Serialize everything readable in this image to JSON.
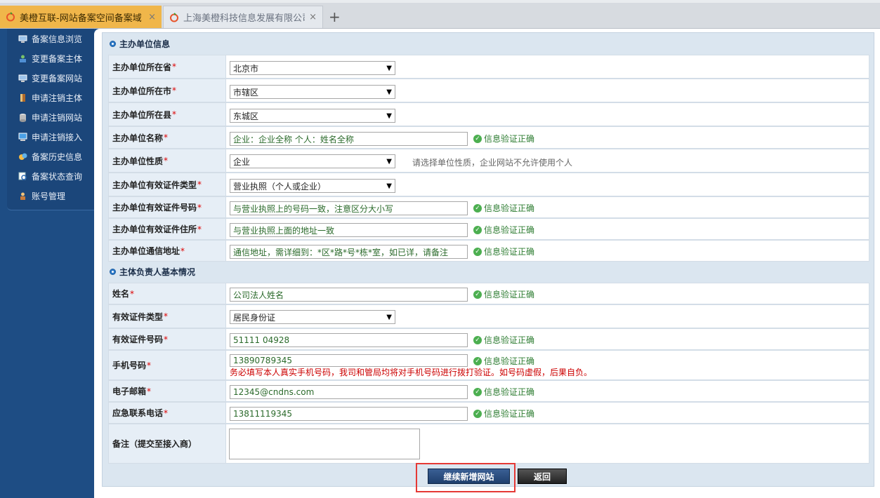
{
  "browser": {
    "tabs": [
      {
        "label": "美橙互联-网站备案空间备案域",
        "close": "×"
      },
      {
        "label": "上海美橙科技信息发展有限公司",
        "close": "×"
      }
    ],
    "new_tab": "+"
  },
  "sidebar": {
    "items": [
      {
        "label": "备案信息浏览",
        "icon": "monitor-icon"
      },
      {
        "label": "变更备案主体",
        "icon": "users-icon"
      },
      {
        "label": "变更备案网站",
        "icon": "monitor-icon"
      },
      {
        "label": "申请注销主体",
        "icon": "door-icon"
      },
      {
        "label": "申请注销网站",
        "icon": "database-icon"
      },
      {
        "label": "申请注销接入",
        "icon": "computer-icon"
      },
      {
        "label": "备案历史信息",
        "icon": "history-icon"
      },
      {
        "label": "备案状态查询",
        "icon": "search-doc-icon"
      },
      {
        "label": "账号管理",
        "icon": "user-icon"
      }
    ]
  },
  "sections": {
    "org": "主办单位信息",
    "person": "主体负责人基本情况"
  },
  "org_rows": {
    "province": {
      "label": "主办单位所在省",
      "value": "北京市"
    },
    "city": {
      "label": "主办单位所在市",
      "value": "市辖区"
    },
    "county": {
      "label": "主办单位所在县",
      "value": "东城区"
    },
    "name": {
      "label": "主办单位名称",
      "value": "企业：企业全称 个人：姓名全称",
      "ok": "信息验证正确"
    },
    "nature": {
      "label": "主办单位性质",
      "value": "企业",
      "hint": "请选择单位性质，企业网站不允许使用个人"
    },
    "cert_type": {
      "label": "主办单位有效证件类型",
      "value": "营业执照（个人或企业）"
    },
    "cert_no": {
      "label": "主办单位有效证件号码",
      "value": "与营业执照上的号码一致，注意区分大小写",
      "ok": "信息验证正确"
    },
    "cert_addr": {
      "label": "主办单位有效证件住所",
      "value": "与营业执照上面的地址一致",
      "ok": "信息验证正确"
    },
    "mail_addr": {
      "label": "主办单位通信地址",
      "value": "通信地址，需详细到：*区*路*号*栋*室，如已详，请备注",
      "ok": "信息验证正确"
    }
  },
  "person_rows": {
    "name": {
      "label": "姓名",
      "value": "公司法人姓名",
      "ok": "信息验证正确"
    },
    "cert_type": {
      "label": "有效证件类型",
      "value": "居民身份证"
    },
    "cert_no": {
      "label": "有效证件号码",
      "value": "51111      04928",
      "ok": "信息验证正确"
    },
    "mobile": {
      "label": "手机号码",
      "value": "13890789345",
      "ok": "信息验证正确",
      "warning": "务必填写本人真实手机号码，我司和管局均将对手机号码进行拨打验证。如号码虚假，后果自负。"
    },
    "email": {
      "label": "电子邮箱",
      "value": "12345@cndns.com",
      "ok": "信息验证正确"
    },
    "emergency": {
      "label": "应急联系电话",
      "value": "13811119345",
      "ok": "信息验证正确"
    },
    "remark": {
      "label": "备注（提交至接入商）"
    }
  },
  "required_mark": "*",
  "buttons": {
    "continue": "继续新增网站",
    "back": "返回"
  }
}
